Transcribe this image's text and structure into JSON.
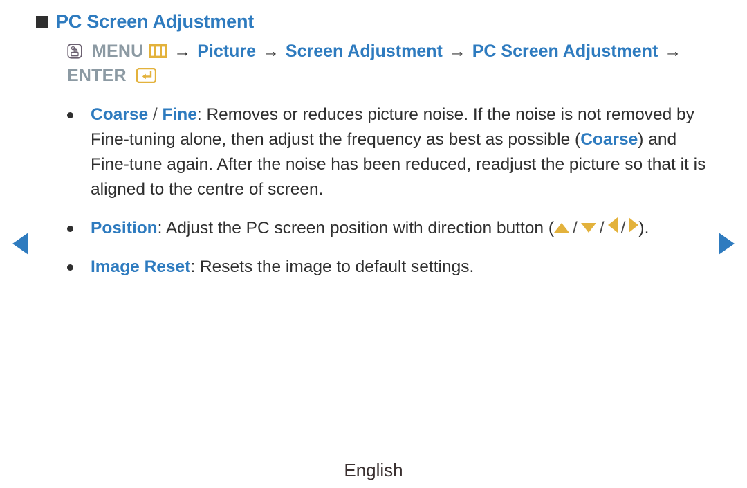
{
  "page": {
    "heading": "PC Screen Adjustment",
    "footer_language": "English"
  },
  "menu_path": {
    "press_icon": "hand-press-icon",
    "menu_label": "MENU",
    "menu_icon": "menu-bars-icon",
    "arrow": "→",
    "step_picture": "Picture",
    "step_screen_adjustment": "Screen Adjustment",
    "step_pc_screen_adjustment": "PC Screen Adjustment",
    "enter_label": "ENTER",
    "enter_icon": "enter-key-icon"
  },
  "bullets": [
    {
      "term_primary": "Coarse",
      "separator": " / ",
      "term_secondary": "Fine",
      "body_part1": ": Removes or reduces picture noise. If the noise is not removed by Fine-tuning alone, then adjust the frequency as best as possible (",
      "inline_term": "Coarse",
      "body_part2": ") and Fine-tune again. After the noise has been reduced, readjust the picture so that it is aligned to the centre of screen."
    },
    {
      "term": "Position",
      "body_part1": ": Adjust the PC screen position with direction button (",
      "arrow_up": "up-triangle-icon",
      "arrow_down": "down-triangle-icon",
      "arrow_left": "left-triangle-icon",
      "arrow_right": "right-triangle-icon",
      "slash": "/",
      "body_part2": ")."
    },
    {
      "term": "Image Reset",
      "body": ": Resets the image to default settings."
    }
  ],
  "navigation": {
    "prev_label": "previous-page",
    "next_label": "next-page"
  },
  "colors": {
    "accent_blue": "#2e7bbf",
    "gold": "#e3b23c",
    "body_text": "#2f2f2f",
    "keycap_gray": "#8c9aa3"
  }
}
